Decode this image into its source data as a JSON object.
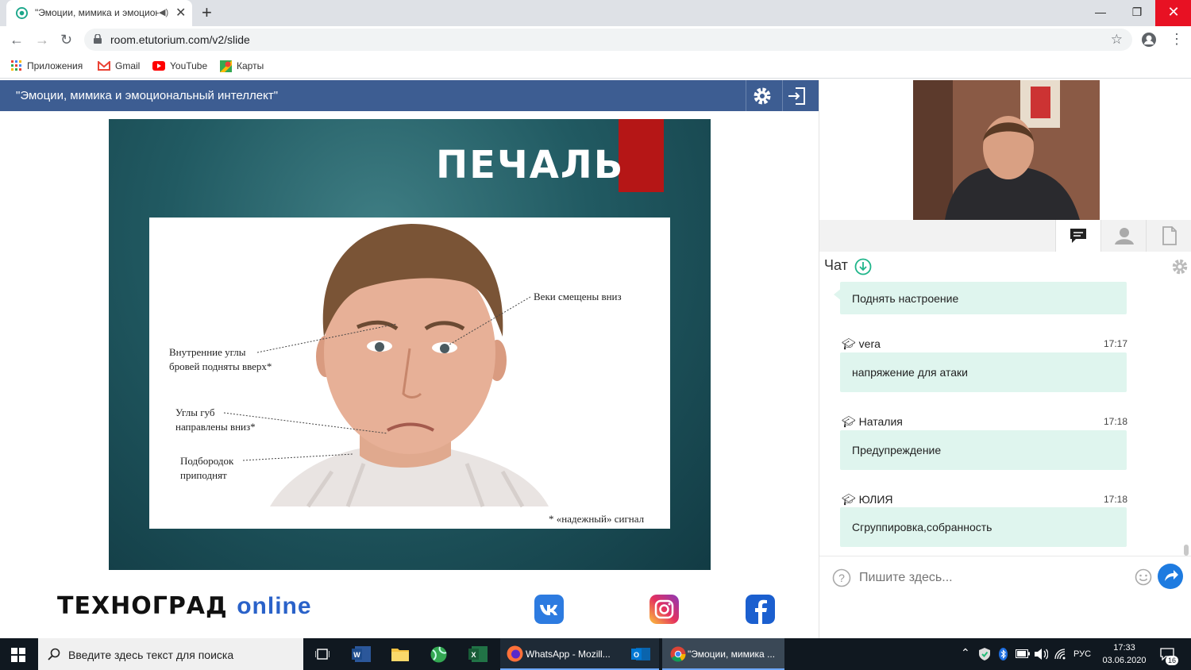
{
  "browser": {
    "tab_title": "\"Эмоции, мимика и эмоциональный интеллект\"",
    "url": "room.etutorium.com/v2/slide",
    "bookmarks": [
      "Приложения",
      "Gmail",
      "YouTube",
      "Карты"
    ]
  },
  "page": {
    "header_title": "\"Эмоции, мимика и эмоциональный интеллект\""
  },
  "slide": {
    "title": "ПЕЧАЛЬ",
    "labels": {
      "eyelids": "Веки смещены вниз",
      "brows_1": "Внутренние углы",
      "brows_2": "бровей подняты вверх*",
      "lips_1": "Углы губ",
      "lips_2": "направлены вниз*",
      "chin_1": "Подбородок",
      "chin_2": "приподнят",
      "footnote": "* «надежный» сигнал"
    }
  },
  "footer": {
    "brand_main": "ТЕХНОГРАД",
    "brand_online": "online"
  },
  "chat": {
    "title": "Чат",
    "messages": [
      {
        "author": "",
        "time": "",
        "text": "Поднять настроение"
      },
      {
        "author": "vera",
        "time": "17:17",
        "text": "напряжение для атаки"
      },
      {
        "author": "Наталия",
        "time": "17:18",
        "text": "Предупреждение"
      },
      {
        "author": "ЮЛИЯ",
        "time": "17:18",
        "text": "Сгруппировка,собранность"
      }
    ],
    "input_placeholder": "Пишите здесь..."
  },
  "taskbar": {
    "search_placeholder": "Введите здесь текст для поиска",
    "apps": [
      {
        "label": "WhatsApp - Mozill..."
      },
      {
        "label": "\"Эмоции, мимика ..."
      }
    ],
    "language": "РУС",
    "time": "17:33",
    "date": "03.06.2020",
    "notifications": "16"
  },
  "colors": {
    "header_blue": "#3d5d92",
    "slide_teal": "#215a62",
    "accent_red": "#b51616",
    "chat_bubble": "#dff5ee",
    "send_blue": "#1e7be0"
  }
}
